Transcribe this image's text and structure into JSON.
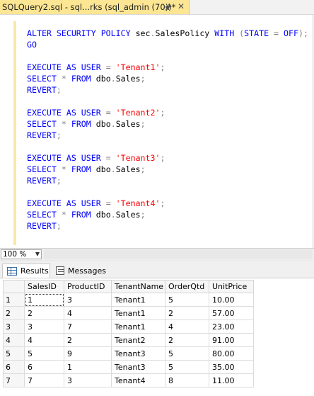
{
  "tab": {
    "title": "SQLQuery2.sql - sql...rks (sql_admin (70))*",
    "pin_icon": "pin-icon",
    "close_icon": "close-icon"
  },
  "editor": {
    "lines": [
      [
        {
          "t": "ALTER SECURITY POLICY ",
          "c": "kw"
        },
        {
          "t": "sec",
          "c": "plain"
        },
        {
          "t": ".",
          "c": "op"
        },
        {
          "t": "SalesPolicy ",
          "c": "plain"
        },
        {
          "t": "WITH ",
          "c": "kw"
        },
        {
          "t": "(",
          "c": "op"
        },
        {
          "t": "STATE ",
          "c": "kw"
        },
        {
          "t": "= ",
          "c": "op"
        },
        {
          "t": "OFF",
          "c": "kw"
        },
        {
          "t": ");",
          "c": "op"
        }
      ],
      [
        {
          "t": "GO",
          "c": "kw"
        }
      ],
      [],
      [
        {
          "t": "EXECUTE AS USER ",
          "c": "kw"
        },
        {
          "t": "= ",
          "c": "op"
        },
        {
          "t": "'Tenant1'",
          "c": "str"
        },
        {
          "t": ";",
          "c": "op"
        }
      ],
      [
        {
          "t": "SELECT ",
          "c": "kw"
        },
        {
          "t": "* ",
          "c": "op"
        },
        {
          "t": "FROM ",
          "c": "kw"
        },
        {
          "t": "dbo",
          "c": "plain"
        },
        {
          "t": ".",
          "c": "op"
        },
        {
          "t": "Sales",
          "c": "plain"
        },
        {
          "t": ";",
          "c": "op"
        }
      ],
      [
        {
          "t": "REVERT",
          "c": "kw"
        },
        {
          "t": ";",
          "c": "op"
        }
      ],
      [],
      [
        {
          "t": "EXECUTE AS USER ",
          "c": "kw"
        },
        {
          "t": "= ",
          "c": "op"
        },
        {
          "t": "'Tenant2'",
          "c": "str"
        },
        {
          "t": ";",
          "c": "op"
        }
      ],
      [
        {
          "t": "SELECT ",
          "c": "kw"
        },
        {
          "t": "* ",
          "c": "op"
        },
        {
          "t": "FROM ",
          "c": "kw"
        },
        {
          "t": "dbo",
          "c": "plain"
        },
        {
          "t": ".",
          "c": "op"
        },
        {
          "t": "Sales",
          "c": "plain"
        },
        {
          "t": ";",
          "c": "op"
        }
      ],
      [
        {
          "t": "REVERT",
          "c": "kw"
        },
        {
          "t": ";",
          "c": "op"
        }
      ],
      [],
      [
        {
          "t": "EXECUTE AS USER ",
          "c": "kw"
        },
        {
          "t": "= ",
          "c": "op"
        },
        {
          "t": "'Tenant3'",
          "c": "str"
        },
        {
          "t": ";",
          "c": "op"
        }
      ],
      [
        {
          "t": "SELECT ",
          "c": "kw"
        },
        {
          "t": "* ",
          "c": "op"
        },
        {
          "t": "FROM ",
          "c": "kw"
        },
        {
          "t": "dbo",
          "c": "plain"
        },
        {
          "t": ".",
          "c": "op"
        },
        {
          "t": "Sales",
          "c": "plain"
        },
        {
          "t": ";",
          "c": "op"
        }
      ],
      [
        {
          "t": "REVERT",
          "c": "kw"
        },
        {
          "t": ";",
          "c": "op"
        }
      ],
      [],
      [
        {
          "t": "EXECUTE AS USER ",
          "c": "kw"
        },
        {
          "t": "= ",
          "c": "op"
        },
        {
          "t": "'Tenant4'",
          "c": "str"
        },
        {
          "t": ";",
          "c": "op"
        }
      ],
      [
        {
          "t": "SELECT ",
          "c": "kw"
        },
        {
          "t": "* ",
          "c": "op"
        },
        {
          "t": "FROM ",
          "c": "kw"
        },
        {
          "t": "dbo",
          "c": "plain"
        },
        {
          "t": ".",
          "c": "op"
        },
        {
          "t": "Sales",
          "c": "plain"
        },
        {
          "t": ";",
          "c": "op"
        }
      ],
      [
        {
          "t": "REVERT",
          "c": "kw"
        },
        {
          "t": ";",
          "c": "op"
        }
      ]
    ]
  },
  "zoom": {
    "value": "100 %",
    "arrow_icon": "chevron-down-icon"
  },
  "results_tabs": {
    "results": "Results",
    "messages": "Messages"
  },
  "grid": {
    "columns": [
      "SalesID",
      "ProductID",
      "TenantName",
      "OrderQtd",
      "UnitPrice"
    ],
    "rows": [
      [
        "1",
        "1",
        "3",
        "Tenant1",
        "5",
        "10.00"
      ],
      [
        "2",
        "2",
        "4",
        "Tenant1",
        "2",
        "57.00"
      ],
      [
        "3",
        "3",
        "7",
        "Tenant1",
        "4",
        "23.00"
      ],
      [
        "4",
        "4",
        "2",
        "Tenant2",
        "2",
        "91.00"
      ],
      [
        "5",
        "5",
        "9",
        "Tenant3",
        "5",
        "80.00"
      ],
      [
        "6",
        "6",
        "1",
        "Tenant3",
        "5",
        "35.00"
      ],
      [
        "7",
        "7",
        "3",
        "Tenant4",
        "8",
        "11.00"
      ]
    ]
  },
  "colors": {
    "tab_active": "#fce593",
    "keyword": "#0000ff",
    "string": "#ff0000",
    "operator": "#808080"
  }
}
